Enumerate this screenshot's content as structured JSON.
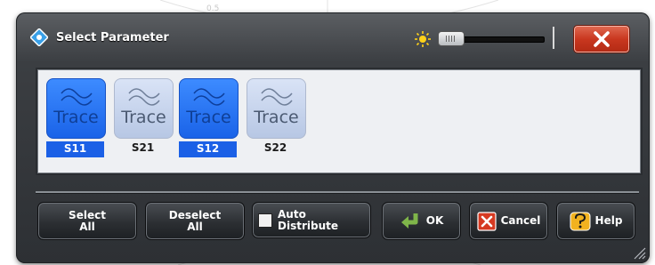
{
  "dialog": {
    "title": "Select Parameter",
    "close_icon": "close-x-icon",
    "brightness_icon": "sun-icon",
    "brightness_level": 0.05
  },
  "tiles": [
    {
      "word": "Trace",
      "label": "S11",
      "selected": true
    },
    {
      "word": "Trace",
      "label": "S21",
      "selected": false
    },
    {
      "word": "Trace",
      "label": "S12",
      "selected": true
    },
    {
      "word": "Trace",
      "label": "S22",
      "selected": false
    }
  ],
  "buttons": {
    "select_all": "Select\nAll",
    "deselect_all": "Deselect\nAll",
    "auto_distribute": "Auto\nDistribute",
    "auto_distribute_checked": false,
    "ok": "OK",
    "ok_icon": "return-arrow-icon",
    "cancel": "Cancel",
    "cancel_icon": "cancel-x-icon",
    "help": "Help",
    "help_icon": "help-question-icon"
  },
  "background_label": "0.5",
  "colors": {
    "selected_tile": "#1a63e8",
    "unselected_tile": "#c7d4ec",
    "close_button": "#c9371f",
    "ok_icon": "#7fb54a",
    "cancel_icon": "#d63a22",
    "help_icon": "#f2b21f"
  }
}
